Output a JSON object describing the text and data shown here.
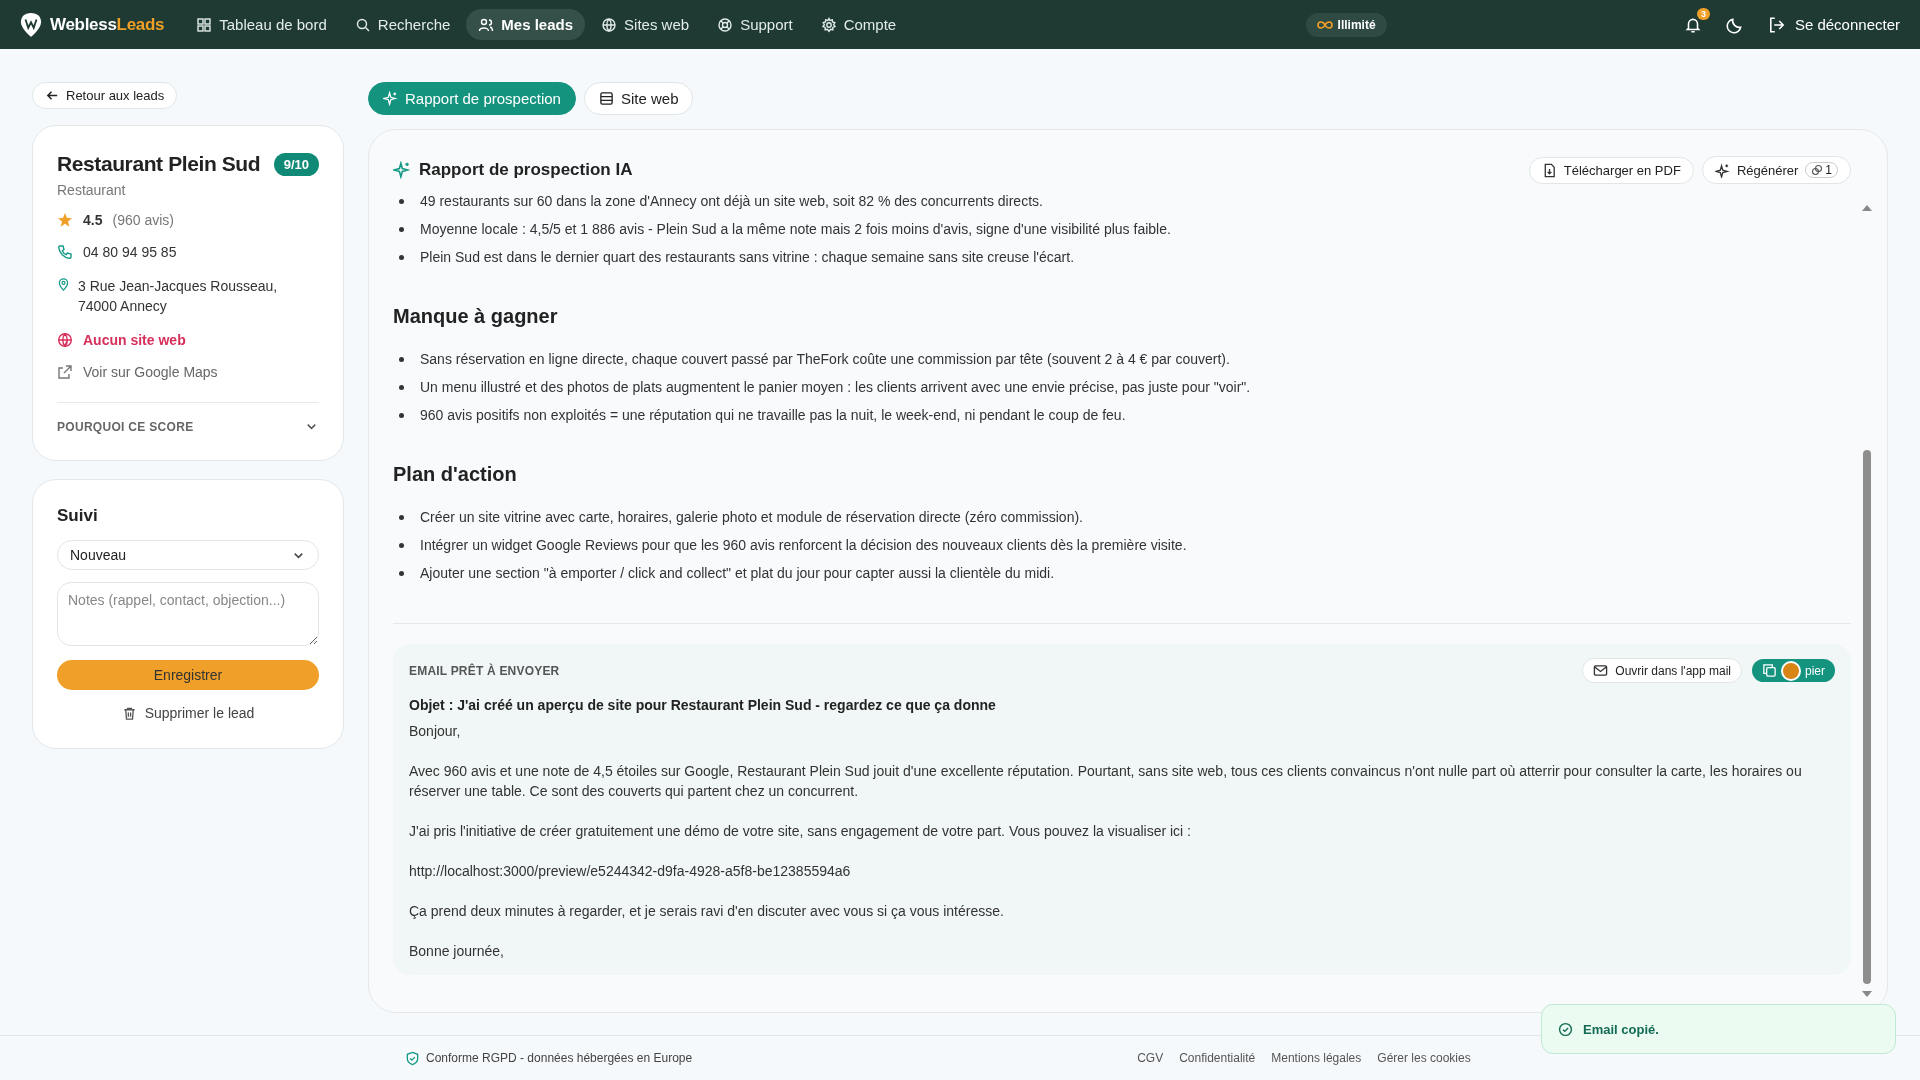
{
  "nav": {
    "logo_part1": "Webless",
    "logo_part2": "Leads",
    "items": [
      {
        "label": "Tableau de bord",
        "selected": false
      },
      {
        "label": "Recherche",
        "selected": false
      },
      {
        "label": "Mes leads",
        "selected": true
      },
      {
        "label": "Sites web",
        "selected": false
      },
      {
        "label": "Support",
        "selected": false
      },
      {
        "label": "Compte",
        "selected": false
      }
    ],
    "plan": "Illimité",
    "notification_count": "3",
    "logout": "Se déconnecter"
  },
  "back": "Retour aux leads",
  "lead": {
    "name": "Restaurant Plein Sud",
    "score": "9/10",
    "category": "Restaurant",
    "rating": "4.5",
    "reviews": "(960 avis)",
    "phone": "04 80 94 95 85",
    "address": [
      "3 Rue Jean-Jacques Rousseau,",
      "74000 Annecy"
    ],
    "no_website": "Aucun site web",
    "maps_link": "Voir sur Google Maps",
    "why_score": {
      "label": "POURQUOI CE SCORE",
      "expanded": false
    }
  },
  "followup": {
    "title": "Suivi",
    "status": "Nouveau",
    "notes_placeholder": "Notes (rappel, contact, objection...)",
    "save": "Enregistrer",
    "delete": "Supprimer le lead"
  },
  "tabs": [
    {
      "label": "Rapport de prospection",
      "selected": true
    },
    {
      "label": "Site web",
      "selected": false
    }
  ],
  "report": {
    "title": "Rapport de prospection IA",
    "download": "Télécharger en PDF",
    "regenerate": "Régénérer",
    "credits": "1",
    "sections": [
      {
        "bullets": [
          "49 restaurants sur 60 dans la zone d'Annecy ont déjà un site web, soit 82 % des concurrents directs.",
          "Moyenne locale : 4,5/5 et 1 886 avis - Plein Sud a la même note mais 2 fois moins d'avis, signe d'une visibilité plus faible.",
          "Plein Sud est dans le dernier quart des restaurants sans vitrine : chaque semaine sans site creuse l'écart."
        ]
      },
      {
        "heading": "Manque à gagner",
        "bullets": [
          "Sans réservation en ligne directe, chaque couvert passé par TheFork coûte une commission par tête (souvent 2 à 4 € par couvert).",
          "Un menu illustré et des photos de plats augmentent le panier moyen : les clients arrivent avec une envie précise, pas juste pour \"voir\".",
          "960 avis positifs non exploités = une réputation qui ne travaille pas la nuit, le week-end, ni pendant le coup de feu."
        ]
      },
      {
        "heading": "Plan d'action",
        "bullets": [
          "Créer un site vitrine avec carte, horaires, galerie photo et module de réservation directe (zéro commission).",
          "Intégrer un widget Google Reviews pour que les 960 avis renforcent la décision des nouveaux clients dès la première visite.",
          "Ajouter une section \"à emporter / click and collect\" et plat du jour pour capter aussi la clientèle du midi."
        ]
      }
    ]
  },
  "email": {
    "label": "EMAIL PRÊT À ENVOYER",
    "open_mail": "Ouvrir dans l'app mail",
    "copy": "pier",
    "subject": "Objet : J'ai créé un aperçu de site pour Restaurant Plein Sud - regardez ce que ça donne",
    "paragraphs": [
      "Bonjour,",
      "Avec 960 avis et une note de 4,5 étoiles sur Google, Restaurant Plein Sud jouit d'une excellente réputation. Pourtant, sans site web, tous ces clients convaincus n'ont nulle part où atterrir pour consulter la carte, les horaires ou réserver une table. Ce sont des couverts qui partent chez un concurrent.",
      "J'ai pris l'initiative de créer gratuitement une démo de votre site, sans engagement de votre part. Vous pouvez la visualiser ici :",
      "http://localhost:3000/preview/e5244342-d9fa-4928-a5f8-be12385594a6",
      "Ça prend deux minutes à regarder, et je serais ravi d'en discuter avec vous si ça vous intéresse.",
      "Bonne journée,"
    ]
  },
  "footer": {
    "compliance": "Conforme RGPD - données hébergées en Europe",
    "links": [
      "CGV",
      "Confidentialité",
      "Mentions légales",
      "Gérer les cookies"
    ]
  },
  "toast": "Email copié."
}
